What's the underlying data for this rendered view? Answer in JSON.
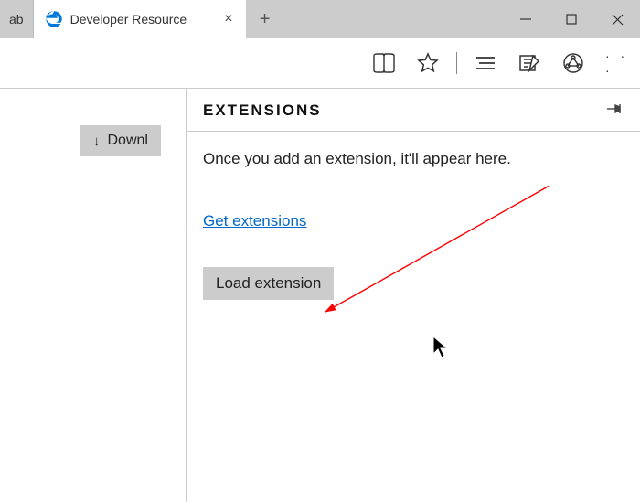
{
  "tabs": {
    "inactive_partial": "ab",
    "active_title": "Developer Resource",
    "close_glyph": "×",
    "newtab_glyph": "+"
  },
  "toolbar": {
    "reading_list_icon": "reading-list",
    "favorites_icon": "star",
    "hub_icon": "hub",
    "notes_icon": "web-notes",
    "share_icon": "share",
    "more_glyph": "· · ·"
  },
  "page": {
    "download_label": "Downl",
    "download_icon_glyph": "↓"
  },
  "panel": {
    "title": "EXTENSIONS",
    "description": "Once you add an extension, it'll appear here.",
    "get_link": "Get extensions",
    "load_button": "Load extension"
  }
}
